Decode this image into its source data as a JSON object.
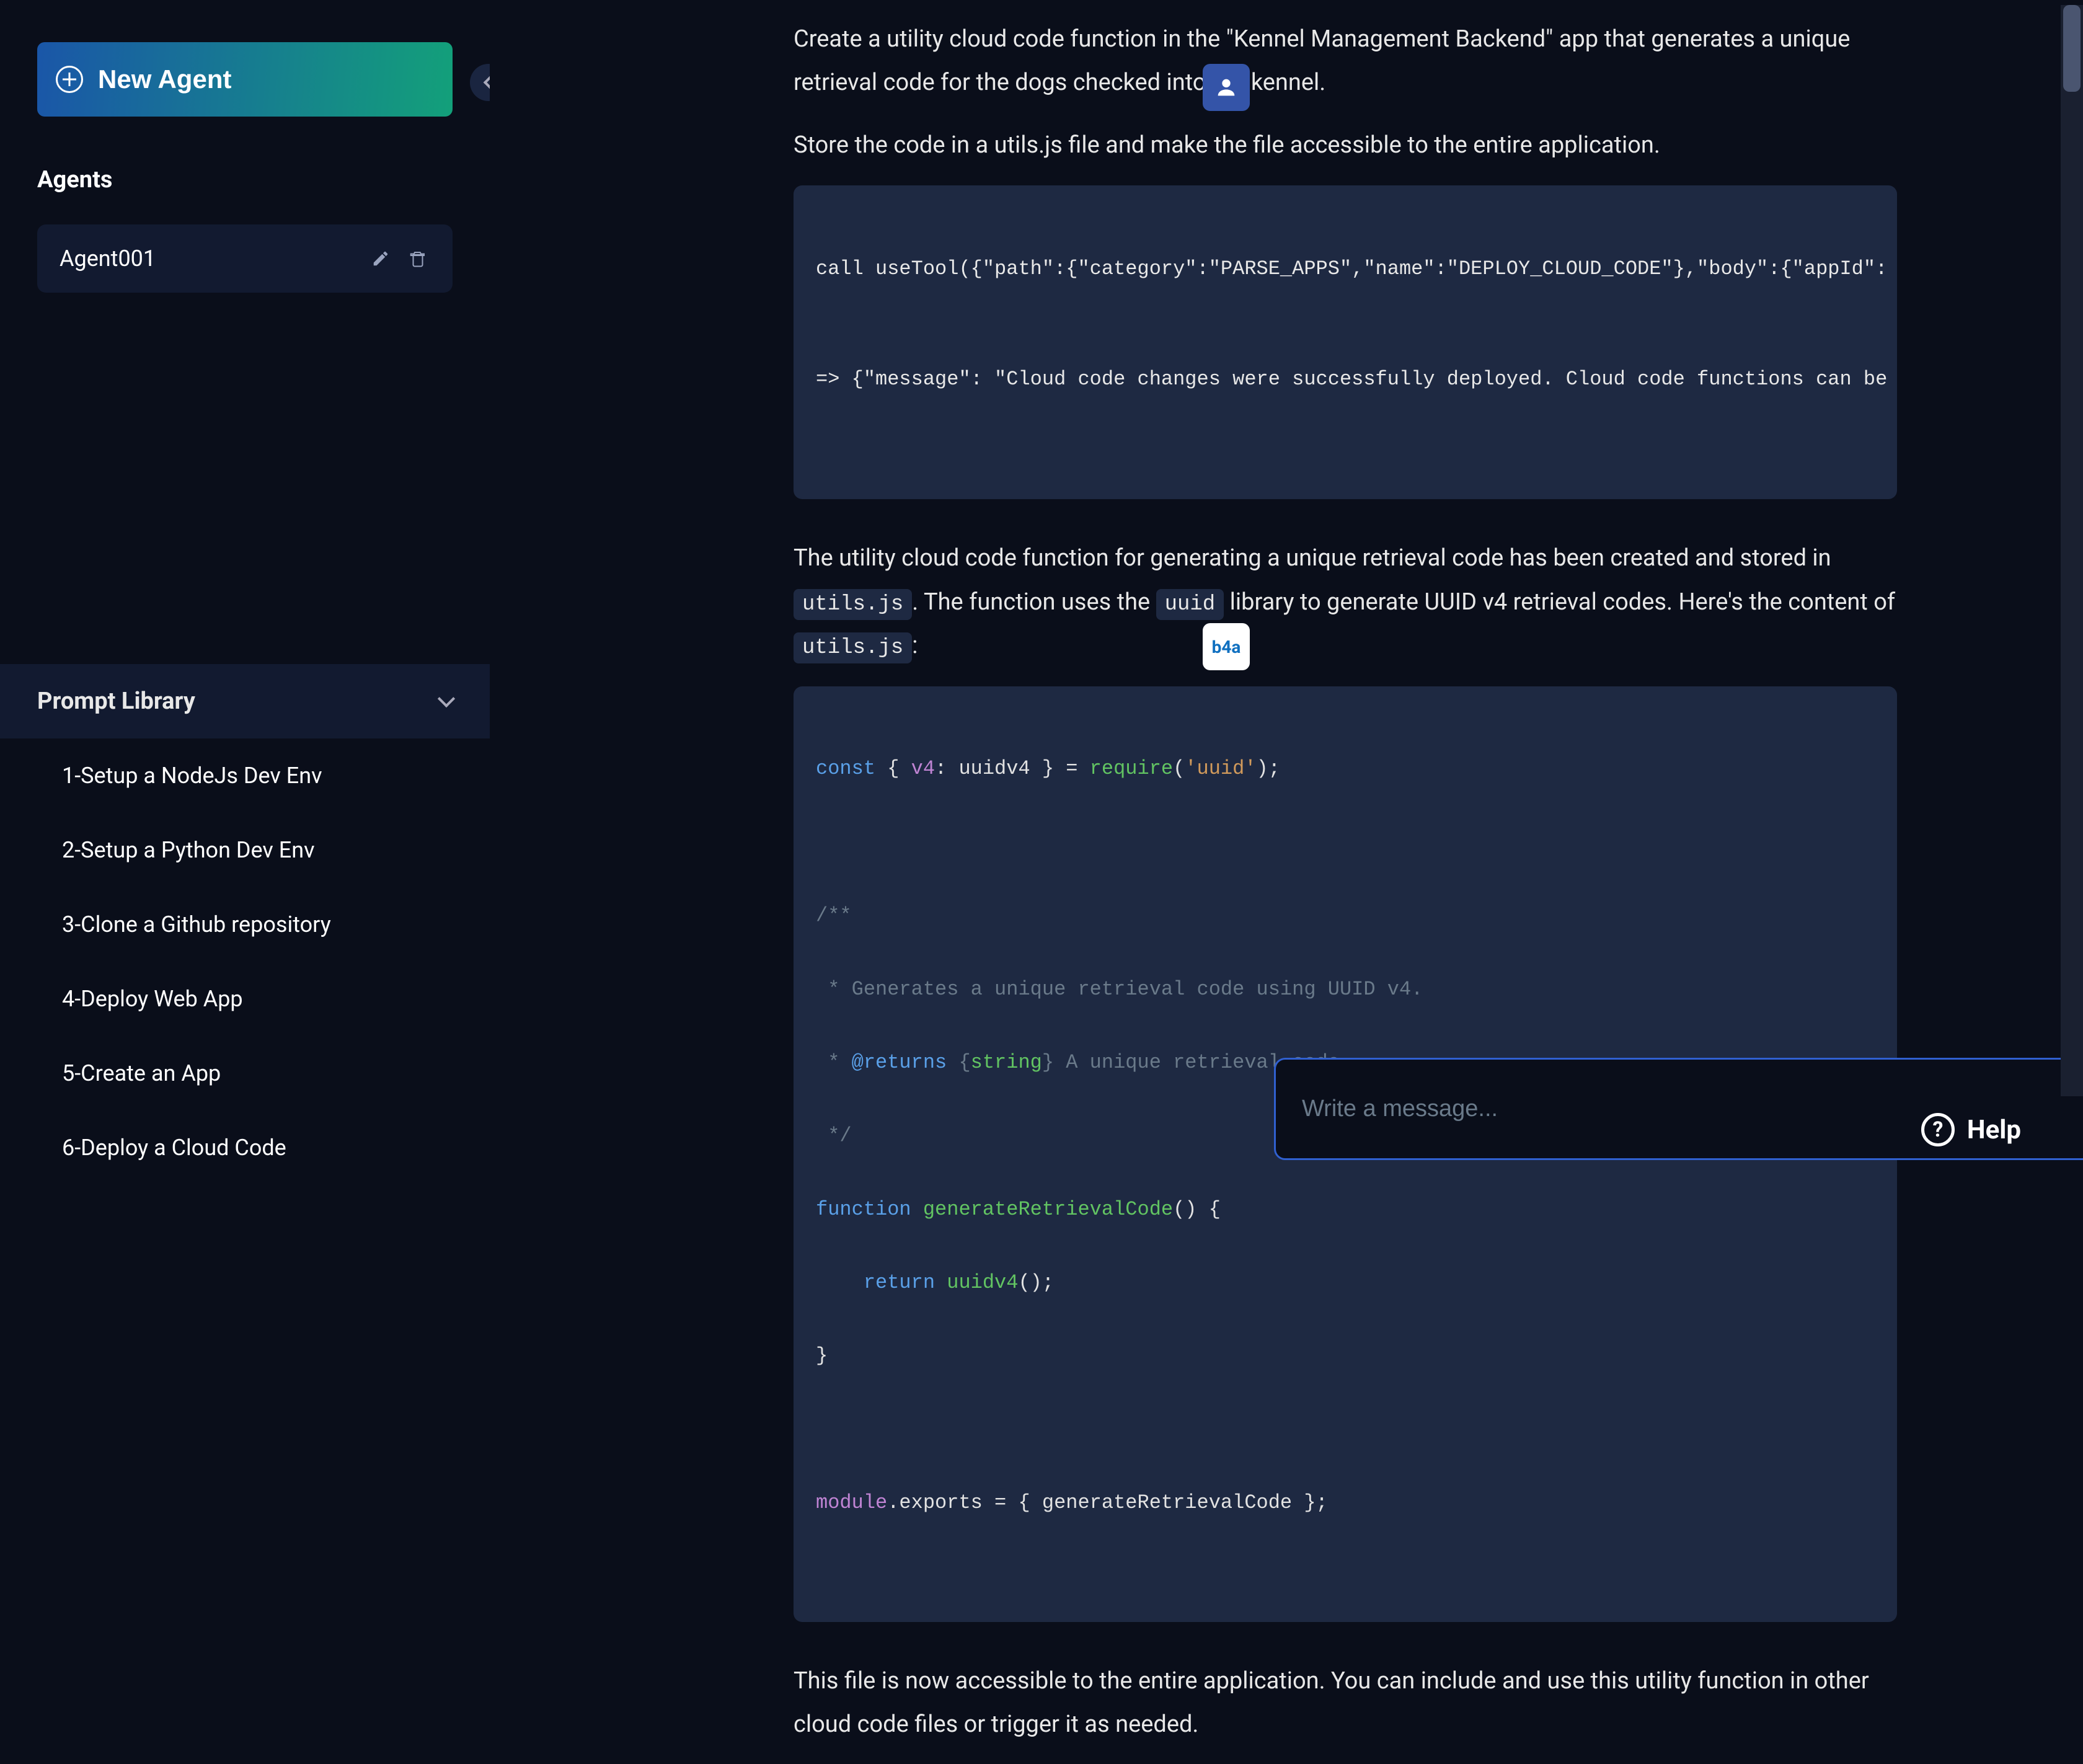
{
  "sidebar": {
    "new_agent_label": "New Agent",
    "agents_heading": "Agents",
    "agent_name": "Agent001",
    "prompt_library_heading": "Prompt Library",
    "items": [
      "1-Setup a NodeJs Dev Env",
      "2-Setup a Python Dev Env",
      "3-Clone a Github repository",
      "4-Deploy Web App",
      "5-Create an App",
      "6-Deploy a Cloud Code"
    ]
  },
  "badges": {
    "b4a": "b4a"
  },
  "prompt": {
    "p1": "Create a utility cloud code function in the \"Kennel Management Backend\" app that generates a unique retrieval code for the dogs checked into the kennel.",
    "p2": "Store the code in a utils.js file and make the file accessible to the entire application."
  },
  "code1": {
    "l1": "call useTool({\"path\":{\"category\":\"PARSE_APPS\",\"name\":\"DEPLOY_CLOUD_CODE\"},\"body\":{\"appId\":",
    "l2": "",
    "l3": "=> {\"message\": \"Cloud code changes were successfully deployed. Cloud code functions can be"
  },
  "reply": {
    "p1a": "The utility cloud code function for generating a unique retrieval code has been created and stored in ",
    "inline1": "utils.js",
    "p1b": ". The function uses the ",
    "inline2": "uuid",
    "p1c": " library to generate UUID v4 retrieval codes. Here's the content of ",
    "inline3": "utils.js",
    "p1d": ":",
    "p2": "This file is now accessible to the entire application. You can include and use this utility function in other cloud code files or trigger it as needed."
  },
  "code2": {
    "const": "const",
    "v4": "v4",
    "uuidv4": "uuidv4",
    "require": "require",
    "uuid_lit": "'uuid'",
    "doc_open": "/**",
    "doc_l1": " * Generates a unique retrieval code using UUID v4.",
    "doc_ret_star": " * ",
    "doc_ret_tag": "@returns",
    "doc_ret_type_open": " {",
    "doc_ret_type": "string",
    "doc_ret_type_close": "}",
    "doc_ret_rest": " A unique retrieval code.",
    "doc_close": " */",
    "function": "function",
    "fnname": "generateRetrievalCode",
    "return": "return",
    "uuidv4_call": "uuidv4",
    "module": "module",
    "exports": "exports",
    "export_name": "generateRetrievalCode"
  },
  "input": {
    "placeholder": "Write a message..."
  },
  "help": {
    "label": "Help",
    "q": "?"
  }
}
